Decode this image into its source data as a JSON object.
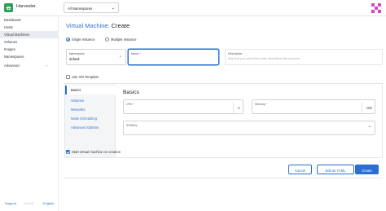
{
  "app": {
    "brand": "Harvester"
  },
  "namespace_selector": {
    "value": "All Namespaces"
  },
  "sidebar": {
    "items": [
      {
        "label": "Dashboard"
      },
      {
        "label": "Hosts"
      },
      {
        "label": "Virtual Machines"
      },
      {
        "label": "Volumes"
      },
      {
        "label": "Images"
      },
      {
        "label": "Namespaces"
      },
      {
        "label": "Advanced"
      }
    ],
    "active_item": "Virtual Machines",
    "footer": {
      "support": "Support",
      "version": "v1.0.0",
      "language": "English"
    }
  },
  "page": {
    "title_prefix": "Virtual Machine:",
    "title_action": "Create"
  },
  "instance_mode": {
    "options": [
      {
        "label": "Single Instance",
        "selected": true
      },
      {
        "label": "Multiple Instance",
        "selected": false
      }
    ]
  },
  "form": {
    "namespace": {
      "label": "Namespace",
      "value": "default"
    },
    "name": {
      "label": "Name",
      "required_mark": "*",
      "value": ""
    },
    "description": {
      "label": "Description",
      "placeholder": "Any text you want that better describes this resource"
    },
    "use_vm_template": {
      "label": "Use VM Template",
      "checked": false
    }
  },
  "tabs": [
    {
      "label": "Basics",
      "active": true
    },
    {
      "label": "Volumes",
      "active": false
    },
    {
      "label": "Networks",
      "active": false
    },
    {
      "label": "Node Scheduling",
      "active": false
    },
    {
      "label": "Advanced Options",
      "active": false
    }
  ],
  "basics": {
    "title": "Basics",
    "cpu": {
      "label": "CPU",
      "required_mark": "*",
      "unit": "C",
      "value": ""
    },
    "memory": {
      "label": "Memory",
      "required_mark": "*",
      "unit": "GiB",
      "value": ""
    },
    "ssh_key": {
      "label": "SSHKey",
      "value": ""
    }
  },
  "start_on_creation": {
    "label": "Start virtual machine on creation",
    "checked": true
  },
  "actions": {
    "cancel": "Cancel",
    "edit_yaml": "Edit as YAML",
    "create": "Create"
  },
  "colors": {
    "accent": "#2a6fd1",
    "brand": "#2a9f5a",
    "avatar": "#d846c8"
  }
}
